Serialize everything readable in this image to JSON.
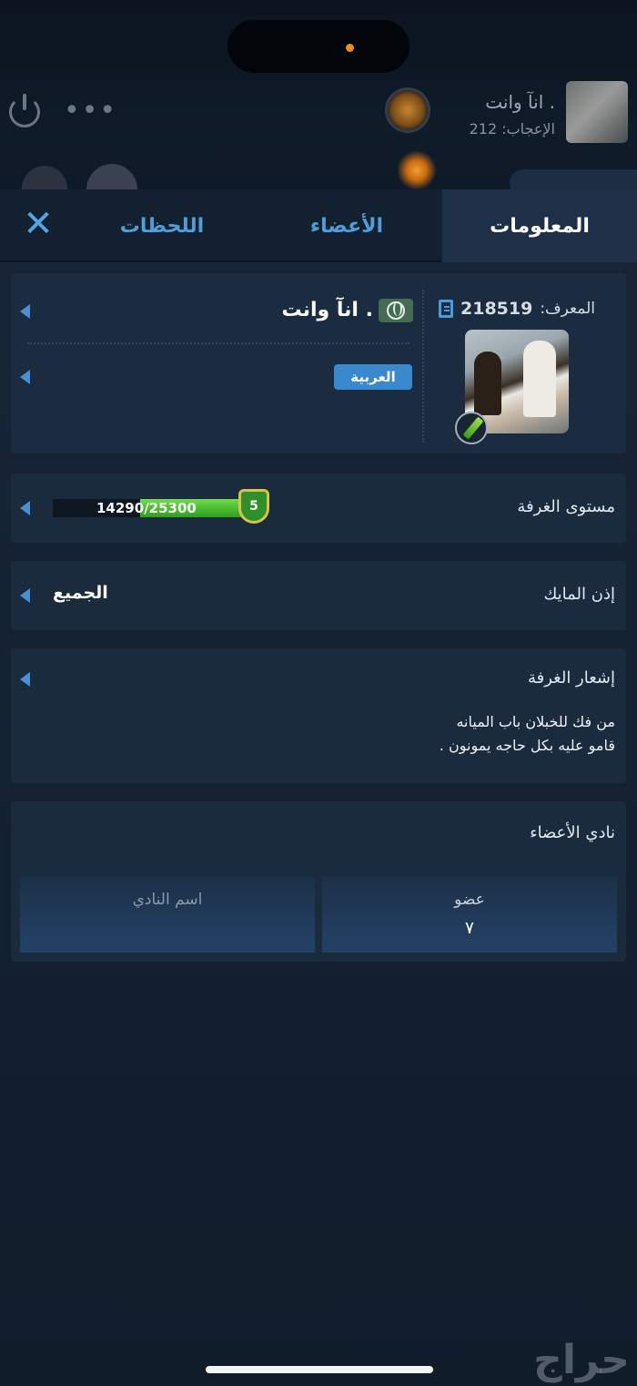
{
  "background_app": {
    "room_name": "انآ وانت .",
    "likes_label": "الإعجاب:",
    "likes_value": "212",
    "icons": [
      "power-icon",
      "more-icon",
      "room-badge-icon"
    ]
  },
  "tabs": [
    {
      "label": "المعلومات",
      "active": true
    },
    {
      "label": "الأعضاء",
      "active": false
    },
    {
      "label": "اللحظات",
      "active": false
    }
  ],
  "close_icon": "close-icon",
  "info": {
    "id_label": "المعرف:",
    "id_value": "218519",
    "room_name": "انآ وانت .",
    "language": "العربية"
  },
  "level": {
    "label": "مستوى الغرفة",
    "current": "14290",
    "max": "25300",
    "level_number": "5",
    "progress": 0.565
  },
  "mic": {
    "label": "إذن المايك",
    "value": "الجميع"
  },
  "announcement": {
    "label": "إشعار الغرفة",
    "line1": "من فك للخبلان باب الميانه",
    "line2": "قامو عليه بكل حاجه يمونون ."
  },
  "club": {
    "title": "نادي الأعضاء",
    "member_label": "عضو",
    "member_value": "٧",
    "name_label": "اسم النادي"
  },
  "watermark": "حراج",
  "colors": {
    "accent": "#4a9be0",
    "panel": "#1a2b3e",
    "active_tab": "#1d3047",
    "xp_green": "#3fb82a"
  }
}
